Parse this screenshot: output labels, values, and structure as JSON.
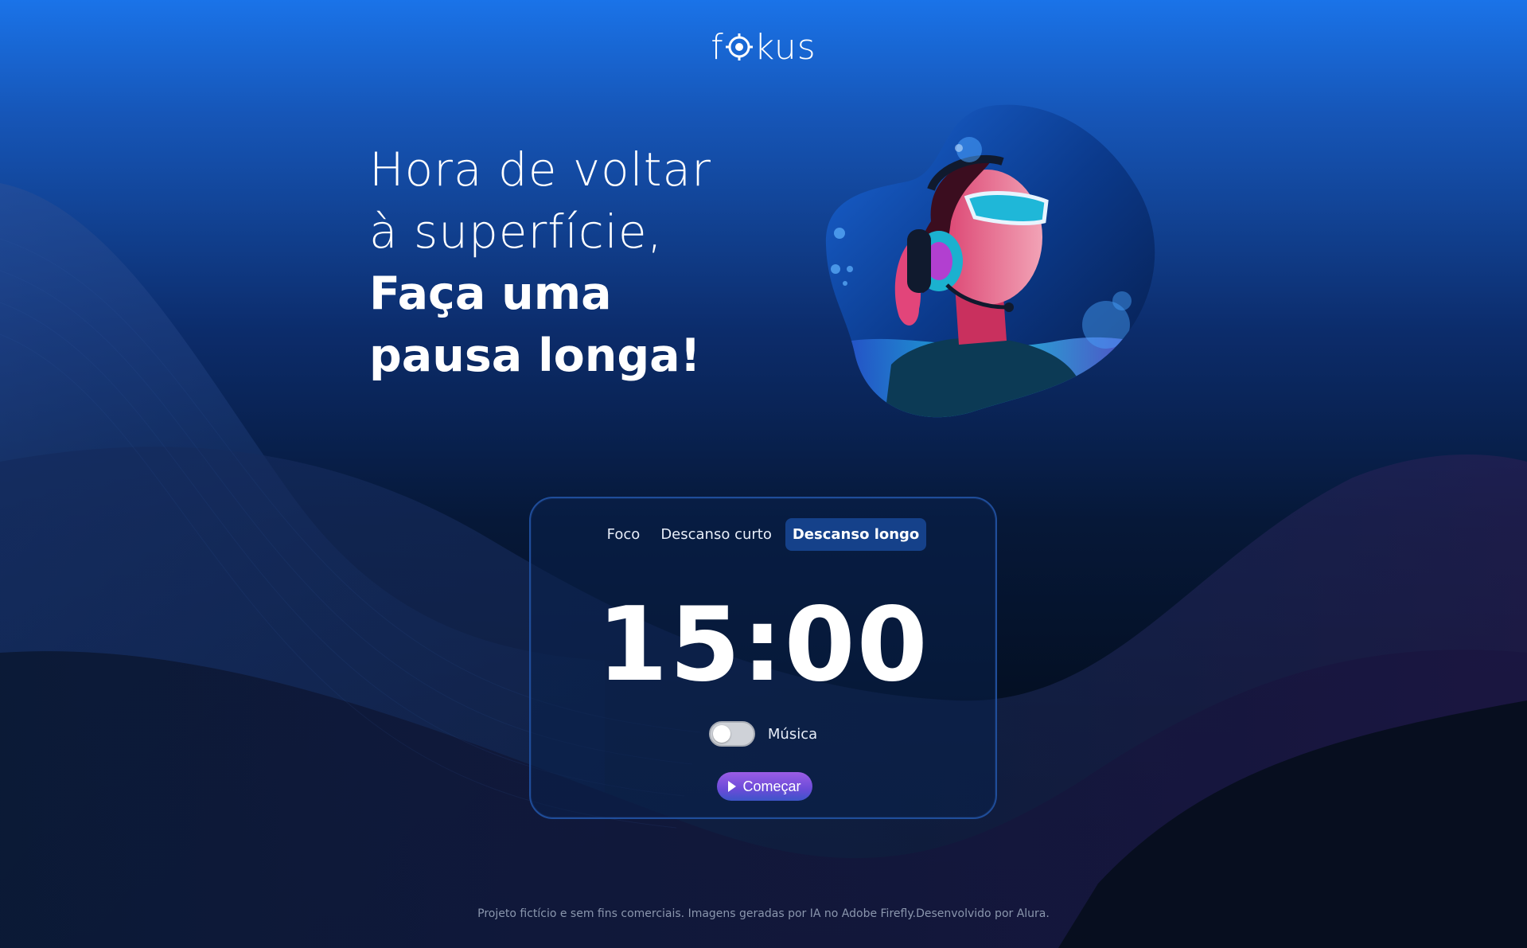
{
  "logo": {
    "text_before": "f",
    "text_after": "kus"
  },
  "headline": {
    "line1": "Hora de voltar",
    "line2": "à superfície,",
    "line3": "Faça uma",
    "line4": "pausa longa!"
  },
  "tabs": [
    {
      "label": "Foco",
      "active": false
    },
    {
      "label": "Descanso curto",
      "active": false
    },
    {
      "label": "Descanso longo",
      "active": true
    }
  ],
  "timer": "15:00",
  "music": {
    "label": "Música",
    "enabled": false
  },
  "start_button": {
    "label": "Começar",
    "icon": "play-icon"
  },
  "footer": "Projeto fictício e sem fins comerciais. Imagens geradas por IA no Adobe Firefly.Desenvolvido por Alura.",
  "colors": {
    "accent": "#15418a",
    "button_top": "#9b5de5",
    "button_bottom": "#3d55c9"
  }
}
